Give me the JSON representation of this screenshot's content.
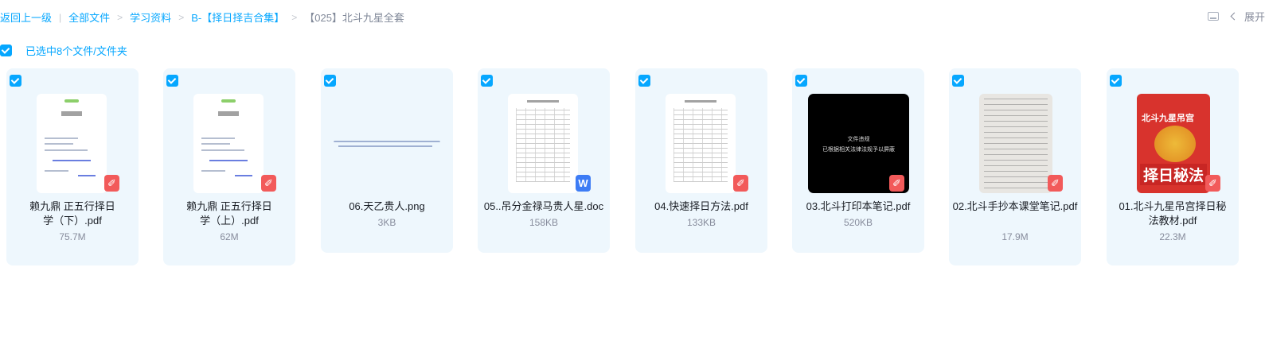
{
  "breadcrumb": {
    "back": "返回上一级",
    "items": [
      "全部文件",
      "学习资料",
      "B-【择日择吉合集】"
    ],
    "current": "【025】北斗九星全套"
  },
  "toolbar": {
    "expand_label": "展开"
  },
  "selection": {
    "label": "已选中8个文件/文件夹"
  },
  "thumb_text": {
    "black_line1": "文件违规",
    "black_line2": "已根据相关法律法规予以屏蔽",
    "book_title": "北斗九星吊宫",
    "book_big": "择日秘法"
  },
  "files": [
    {
      "name": "赖九鼎 正五行择日学（下）.pdf",
      "size": "75.7M",
      "type": "pdf",
      "badge": "pdf-icon",
      "thumb": "document"
    },
    {
      "name": "赖九鼎 正五行择日学（上）.pdf",
      "size": "62M",
      "type": "pdf",
      "badge": "pdf-icon",
      "thumb": "document"
    },
    {
      "name": "06.天乙贵人.png",
      "size": "3KB",
      "type": "png",
      "badge": "",
      "thumb": "strip"
    },
    {
      "name": "05..吊分金禄马贵人星.doc",
      "size": "158KB",
      "type": "doc",
      "badge": "word-icon",
      "thumb": "table"
    },
    {
      "name": "04.快速择日方法.pdf",
      "size": "133KB",
      "type": "pdf",
      "badge": "pdf-icon",
      "thumb": "table"
    },
    {
      "name": "03.北斗打印本笔记.pdf",
      "size": "520KB",
      "type": "pdf",
      "badge": "pdf-icon",
      "thumb": "blocked"
    },
    {
      "name": "02.北斗手抄本课堂笔记.pdf",
      "size": "17.9M",
      "type": "pdf",
      "badge": "pdf-icon",
      "thumb": "handwritten"
    },
    {
      "name": "01.北斗九星吊宫择日秘法教材.pdf",
      "size": "22.3M",
      "type": "pdf",
      "badge": "pdf-icon",
      "thumb": "book"
    }
  ],
  "colors": {
    "accent": "#06a7ff",
    "card_bg": "#eef7fd",
    "pdf_badge": "#f25a5a",
    "doc_badge": "#3d7cf5"
  }
}
